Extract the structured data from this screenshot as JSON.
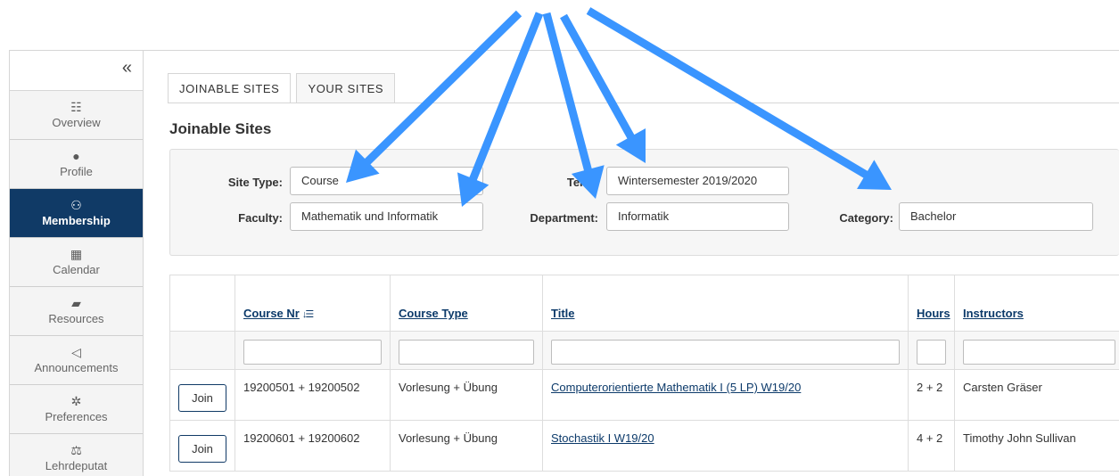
{
  "sidebar": {
    "collapse_icon": "«",
    "items": [
      {
        "label": "Overview",
        "icon": "list-icon",
        "glyph": "☷",
        "active": false
      },
      {
        "label": "Profile",
        "icon": "user-icon",
        "glyph": "●",
        "active": false
      },
      {
        "label": "Membership",
        "icon": "users-icon",
        "glyph": "⚇",
        "active": true
      },
      {
        "label": "Calendar",
        "icon": "calendar-icon",
        "glyph": "▦",
        "active": false
      },
      {
        "label": "Resources",
        "icon": "folder-icon",
        "glyph": "▰",
        "active": false
      },
      {
        "label": "Announcements",
        "icon": "bullhorn-icon",
        "glyph": "◁",
        "active": false
      },
      {
        "label": "Preferences",
        "icon": "gear-icon",
        "glyph": "✲",
        "active": false
      },
      {
        "label": "Lehrdeputat",
        "icon": "scale-icon",
        "glyph": "⚖",
        "active": false
      }
    ]
  },
  "tabs": [
    {
      "label": "JOINABLE SITES",
      "active": true
    },
    {
      "label": "YOUR SITES",
      "active": false
    }
  ],
  "page_title": "Joinable Sites",
  "filters": {
    "site_type": {
      "label": "Site Type:",
      "value": "Course"
    },
    "term": {
      "label": "Term:",
      "value": "Wintersemester 2019/2020"
    },
    "faculty": {
      "label": "Faculty:",
      "value": "Mathematik und Informatik"
    },
    "department": {
      "label": "Department:",
      "value": "Informatik"
    },
    "category": {
      "label": "Category:",
      "value": "Bachelor"
    }
  },
  "table": {
    "columns": {
      "course_nr": "Course Nr",
      "course_type": "Course Type",
      "title": "Title",
      "hours": "Hours",
      "instructors": "Instructors"
    },
    "sort_icon": "sort-amount-down-icon",
    "rows": [
      {
        "action": "Join",
        "course_nr": "19200501 + 19200502",
        "course_type": "Vorlesung + Übung",
        "title": "Computerorientierte Mathematik I (5 LP) W19/20",
        "hours": "2 + 2",
        "instructors": "Carsten Gräser"
      },
      {
        "action": "Join",
        "course_nr": "19200601 + 19200602",
        "course_type": "Vorlesung + Übung",
        "title": "Stochastik I W19/20",
        "hours": "4 + 2",
        "instructors": "Timothy John Sullivan"
      }
    ]
  },
  "annotation": {
    "arrow_color": "#3a95ff"
  }
}
